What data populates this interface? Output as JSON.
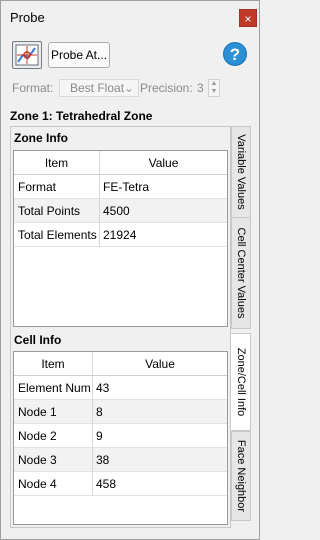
{
  "window": {
    "title": "Probe",
    "close_glyph": "×"
  },
  "toolbar": {
    "probe_at_label": "Probe At...",
    "help_glyph": "?"
  },
  "options": {
    "format_label": "Format:",
    "format_value": "Best Float",
    "precision_label": "Precision:",
    "precision_value": "3"
  },
  "zone": {
    "title": "Zone 1: Tetrahedral Zone"
  },
  "zone_info": {
    "title": "Zone Info",
    "columns": [
      "Item",
      "Value"
    ],
    "rows": [
      {
        "item": "Format",
        "value": "FE-Tetra"
      },
      {
        "item": "Total Points",
        "value": "4500"
      },
      {
        "item": "Total Elements",
        "value": "21924"
      }
    ]
  },
  "cell_info": {
    "title": "Cell Info",
    "columns": [
      "Item",
      "Value"
    ],
    "rows": [
      {
        "item": "Element Num",
        "value": "43"
      },
      {
        "item": "Node 1",
        "value": "8"
      },
      {
        "item": "Node 2",
        "value": "9"
      },
      {
        "item": "Node 3",
        "value": "38"
      },
      {
        "item": "Node 4",
        "value": "458"
      }
    ]
  },
  "tabs": [
    {
      "label": "Variable Values",
      "active": false
    },
    {
      "label": "Cell Center Values",
      "active": false
    },
    {
      "label": "Zone/Cell Info",
      "active": true
    },
    {
      "label": "Face Neighbor",
      "active": false
    }
  ],
  "colors": {
    "close_button": "#c0392b",
    "help_icon": "#2b8fd6",
    "alt_row": "#f2f2f2"
  }
}
